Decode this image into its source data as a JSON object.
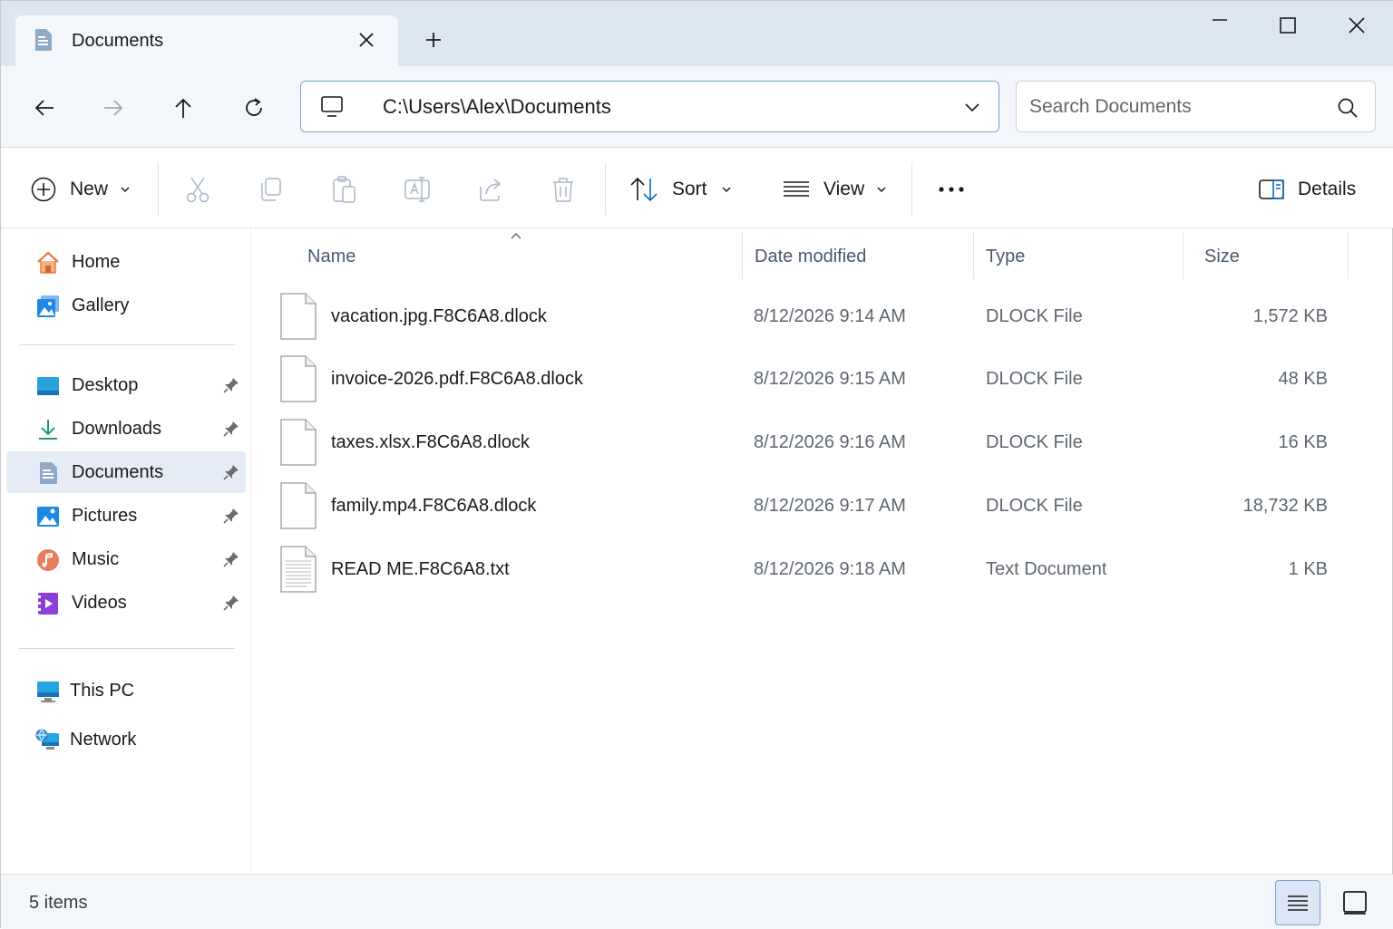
{
  "tab": {
    "title": "Documents"
  },
  "address": {
    "path": "C:\\Users\\Alex\\Documents"
  },
  "search": {
    "placeholder": "Search Documents"
  },
  "commands": {
    "new": "New",
    "sort": "Sort",
    "view": "View",
    "details": "Details"
  },
  "sidebar": {
    "quick": [
      {
        "label": "Home",
        "icon": "home-icon"
      },
      {
        "label": "Gallery",
        "icon": "gallery-icon"
      }
    ],
    "pinned": [
      {
        "label": "Desktop",
        "icon": "desktop-icon"
      },
      {
        "label": "Downloads",
        "icon": "downloads-icon"
      },
      {
        "label": "Documents",
        "icon": "documents-icon",
        "active": true
      },
      {
        "label": "Pictures",
        "icon": "pictures-icon"
      },
      {
        "label": "Music",
        "icon": "music-icon"
      },
      {
        "label": "Videos",
        "icon": "videos-icon"
      }
    ],
    "locations": [
      {
        "label": "This PC",
        "icon": "this-pc-icon"
      },
      {
        "label": "Network",
        "icon": "network-icon"
      }
    ]
  },
  "columns": {
    "name": "Name",
    "date": "Date modified",
    "type": "Type",
    "size": "Size"
  },
  "files": [
    {
      "name": "vacation.jpg.F8C6A8.dlock",
      "date": "8/12/2026 9:14 AM",
      "type": "DLOCK File",
      "size": "1,572 KB",
      "icon": "blank-file-icon"
    },
    {
      "name": "invoice-2026.pdf.F8C6A8.dlock",
      "date": "8/12/2026 9:15 AM",
      "type": "DLOCK File",
      "size": "48 KB",
      "icon": "blank-file-icon"
    },
    {
      "name": "taxes.xlsx.F8C6A8.dlock",
      "date": "8/12/2026 9:16 AM",
      "type": "DLOCK File",
      "size": "16 KB",
      "icon": "blank-file-icon"
    },
    {
      "name": "family.mp4.F8C6A8.dlock",
      "date": "8/12/2026 9:17 AM",
      "type": "DLOCK File",
      "size": "18,732 KB",
      "icon": "blank-file-icon"
    },
    {
      "name": "READ ME.F8C6A8.txt",
      "date": "8/12/2026 9:18 AM",
      "type": "Text Document",
      "size": "1 KB",
      "icon": "text-file-icon"
    }
  ],
  "status": {
    "count": "5 items"
  },
  "colors": {
    "accent": "#0f6cbd",
    "titlebar": "#dce6f2",
    "selection": "#e5ecf6"
  }
}
